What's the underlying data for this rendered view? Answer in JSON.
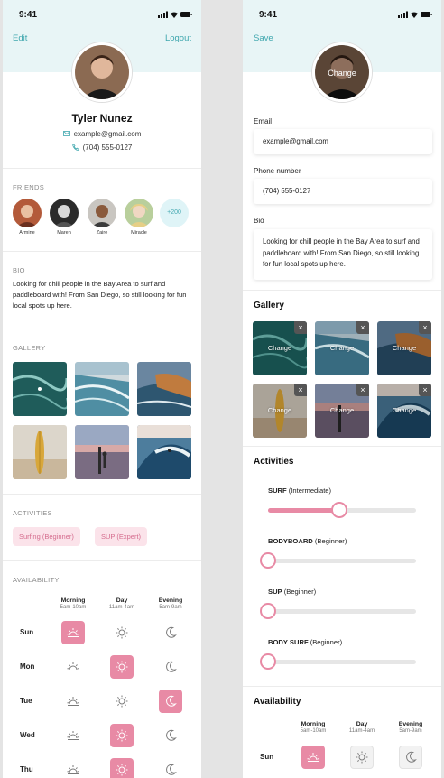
{
  "status_time": "9:41",
  "profile_view": {
    "edit_label": "Edit",
    "logout_label": "Logout",
    "name": "Tyler Nunez",
    "email": "example@gmail.com",
    "phone": "(704) 555-0127",
    "friends_title": "FRIENDS",
    "friends": [
      "Armine",
      "Maren",
      "Zaire",
      "Miracle"
    ],
    "more_friends": "+200",
    "bio_title": "BIO",
    "bio": "Looking for chill people in the Bay Area to surf and paddleboard with! From San Diego, so still looking for fun local spots up here.",
    "gallery_title": "GALLERY",
    "activities_title": "ACTIVITIES",
    "activities": [
      "Surfing (Beginner)",
      "SUP (Expert)"
    ],
    "availability_title": "AVAILABILITY",
    "periods": [
      {
        "name": "Morning",
        "hours": "5am-10am"
      },
      {
        "name": "Day",
        "hours": "11am-4am"
      },
      {
        "name": "Evening",
        "hours": "5am-9am"
      }
    ],
    "days": [
      {
        "day": "Sun",
        "selected": [
          true,
          false,
          false
        ]
      },
      {
        "day": "Mon",
        "selected": [
          false,
          true,
          false
        ]
      },
      {
        "day": "Tue",
        "selected": [
          false,
          false,
          true
        ]
      },
      {
        "day": "Wed",
        "selected": [
          false,
          true,
          false
        ]
      },
      {
        "day": "Thu",
        "selected": [
          false,
          true,
          false
        ]
      }
    ]
  },
  "edit_view": {
    "save_label": "Save",
    "change_label": "Change",
    "email_label": "Email",
    "email_value": "example@gmail.com",
    "phone_label": "Phone number",
    "phone_value": "(704) 555-0127",
    "bio_label": "Bio",
    "bio_value": "Looking for chill people in the Bay Area to surf and paddleboard with! From San Diego, so still looking for fun local spots up here.",
    "gallery_title": "Gallery",
    "gallery_change": "Change",
    "remove_icon": "×",
    "activities_title": "Activities",
    "activities": [
      {
        "name": "SURF",
        "level": "(Intermediate)",
        "value": 0.48
      },
      {
        "name": "BODYBOARD",
        "level": "(Beginner)",
        "value": 0.0
      },
      {
        "name": "SUP",
        "level": "(Beginner)",
        "value": 0.0
      },
      {
        "name": "BODY SURF",
        "level": "(Beginner)",
        "value": 0.0
      }
    ],
    "availability_title": "Availability",
    "periods": [
      {
        "name": "Morning",
        "hours": "5am-10am"
      },
      {
        "name": "Day",
        "hours": "11am-4am"
      },
      {
        "name": "Evening",
        "hours": "5am-9am"
      }
    ],
    "days": [
      {
        "day": "Sun",
        "selected": [
          true,
          false,
          false
        ]
      }
    ]
  },
  "colors": {
    "accent_pink": "#e88aa5",
    "accent_teal": "#3fa7ae",
    "header_bg": "#e8f5f6"
  }
}
